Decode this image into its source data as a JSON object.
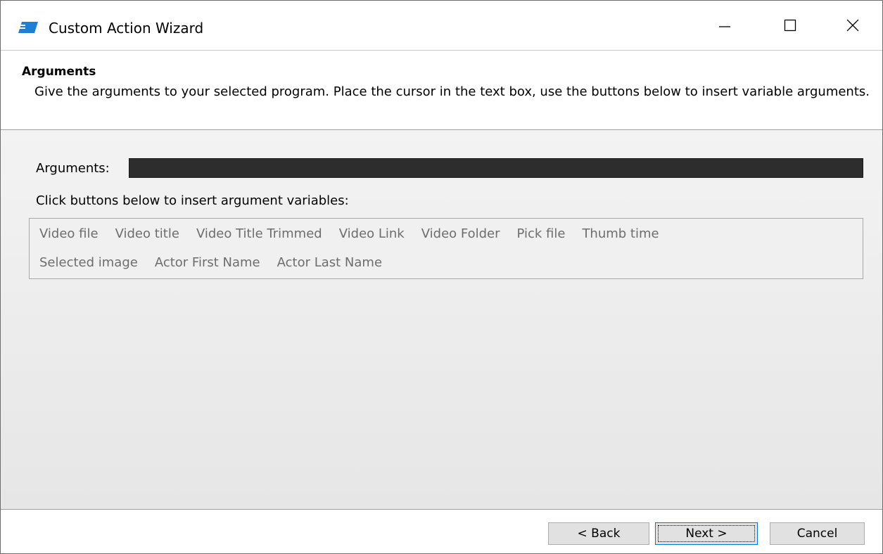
{
  "window": {
    "title": "Custom Action Wizard",
    "icon": "app-icon"
  },
  "header": {
    "title": "Arguments",
    "description": "Give the arguments to your selected program. Place the cursor in the text box, use the buttons below to insert variable arguments."
  },
  "form": {
    "arguments_label": "Arguments:",
    "arguments_value": "",
    "hint": "Click buttons below to insert argument variables:"
  },
  "variables": {
    "row1": [
      "Video file",
      "Video title",
      "Video Title Trimmed",
      "Video Link",
      "Video Folder",
      "Pick file",
      "Thumb time"
    ],
    "row2": [
      "Selected image",
      "Actor First Name",
      "Actor Last Name"
    ]
  },
  "footer": {
    "back_label": "< Back",
    "next_label": "Next >",
    "cancel_label": "Cancel"
  },
  "colors": {
    "accent": "#0078d7",
    "input_bg": "#2d2d2d",
    "disabled_text": "#6d6d6d"
  }
}
